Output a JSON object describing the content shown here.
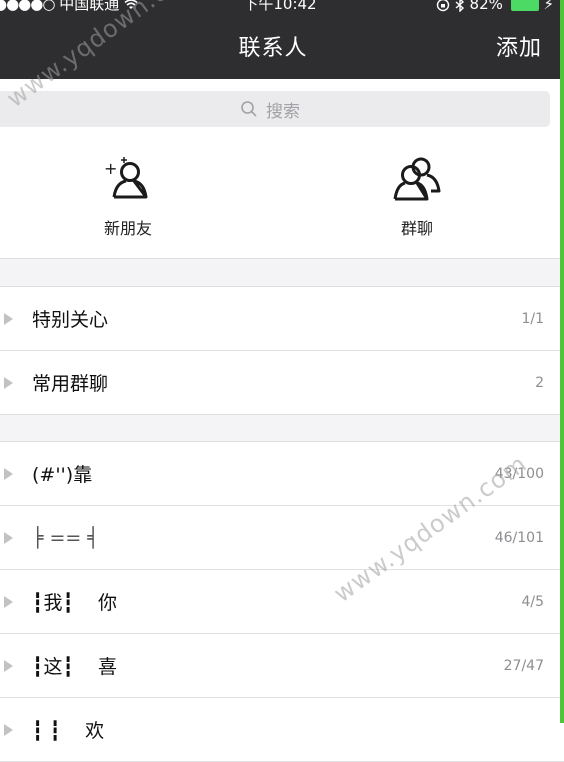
{
  "status_bar": {
    "signal_dots": "●●●●○",
    "carrier": "中国联通",
    "time": "下午10:42",
    "battery_percent": "82%",
    "battery_level": 0.82
  },
  "nav": {
    "title": "联系人",
    "action": "添加"
  },
  "search": {
    "placeholder": "搜索"
  },
  "quick_actions": [
    {
      "label": "新朋友",
      "icon": "add-friend-icon"
    },
    {
      "label": "群聊",
      "icon": "group-chat-icon"
    }
  ],
  "top_groups": [
    {
      "name": "特别关心",
      "count": "1/1"
    },
    {
      "name": "常用群聊",
      "count": "2"
    }
  ],
  "friend_groups": [
    {
      "name": "(#'')靠",
      "count": "43/100"
    },
    {
      "name": "╞ == ╡",
      "count": "46/101"
    },
    {
      "name": "┇我┇    你",
      "count": "4/5"
    },
    {
      "name": "┇这┇    喜",
      "count": "27/47"
    },
    {
      "name": "┇ ┇    欢",
      "count": ""
    }
  ],
  "watermark": {
    "text": "www.yqdown.com"
  },
  "colors": {
    "nav_bg": "#2e2e30",
    "accent_green": "#4fc63a",
    "page_bg": "#f4f4f6"
  }
}
